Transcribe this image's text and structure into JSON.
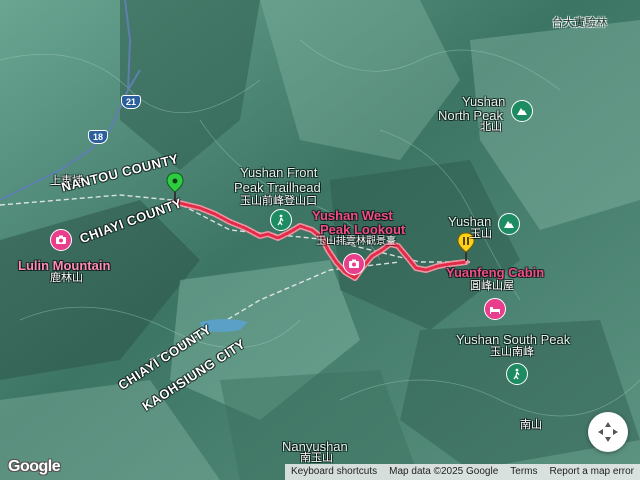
{
  "colors": {
    "route": "#e9435a",
    "route_outline": "#ff8fa0",
    "accent_pink": "#f04e8a",
    "poi_green": "#1e8c63",
    "poi_pink": "#e83e8c"
  },
  "labels": {
    "top_right": "台大實驗林",
    "shangdongpu": "上東埔",
    "nantou_county": "NANTOU COUNTY",
    "chiayi_county_1": "CHIAYI COUNTY",
    "chiayi_county_2": "CHIAYI COUNTY",
    "kaohsiung_city": "KAOHSIUNG CITY",
    "lulin_en": "Lulin Mountain",
    "lulin_zh": "鹿林山",
    "front_peak_en_1": "Yushan Front",
    "front_peak_en_2": "Peak Trailhead",
    "front_peak_zh": "玉山前峰登山口",
    "west_peak_en_1": "Yushan West",
    "west_peak_en_2": "Peak Lookout",
    "west_peak_zh": "玉山排雲林觀景臺",
    "north_peak_en_1": "Yushan",
    "north_peak_en_2": "North Peak",
    "north_peak_zh": "北山",
    "yushan_en": "Yushan",
    "yushan_zh": "玉山",
    "yuanfeng_en": "Yuanfeng Cabin",
    "yuanfeng_zh": "圓峰山屋",
    "south_peak_en": "Yushan South Peak",
    "south_peak_zh": "玉山南峰",
    "nanshan_zh": "南山",
    "nanyushan_en": "Nanyushan",
    "nanyushan_zh": "南玉山"
  },
  "roads": {
    "route_21": "21",
    "route_18": "18"
  },
  "icons": {
    "start_marker": "green-pin-icon",
    "end_marker": "yellow-pin-icon",
    "mountain": "mountain-icon",
    "hiker": "hiker-icon",
    "camera": "camera-icon",
    "lodging": "bed-icon",
    "compass": "compass-icon"
  },
  "branding": {
    "logo": "Google"
  },
  "attribution": {
    "shortcuts": "Keyboard shortcuts",
    "data": "Map data ©2025 Google",
    "terms": "Terms",
    "report": "Report a map error"
  }
}
